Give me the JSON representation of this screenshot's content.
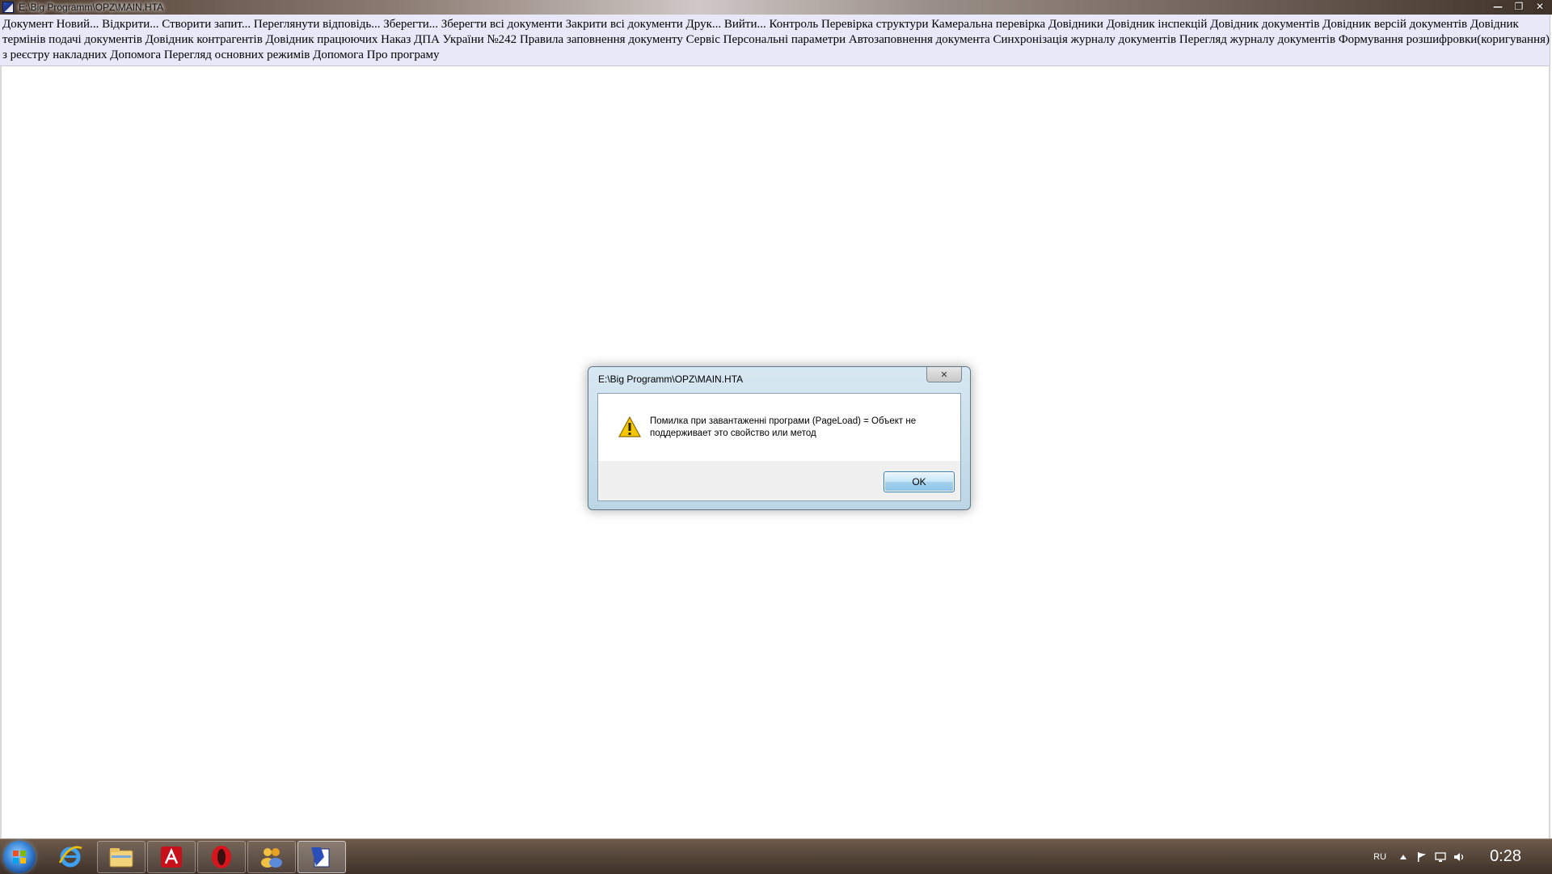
{
  "window": {
    "title": "E:\\Big Programm\\OPZ\\MAIN.HTA",
    "controls": {
      "minimize": "—",
      "maximize": "❐",
      "close": "✕"
    }
  },
  "menu": {
    "items": [
      "Документ",
      "Новий...",
      "Відкрити...",
      "Створити запит...",
      "Переглянути відповідь...",
      "Зберегти...",
      "Зберегти всі документи",
      "Закрити всі документи",
      "Друк...",
      "Вийти...",
      "Контроль",
      "Перевірка структури",
      "Камеральна перевірка",
      "Довідники",
      "Довідник інспекцій",
      "Довідник документів",
      "Довідник версій документів",
      "Довідник термінів подачі документів",
      "Довідник контрагентів",
      "Довідник працюючих",
      "Наказ ДПА України №242",
      "Правила заповнення документу",
      "Сервіс",
      "Персональні параметри",
      "Автозаповнення документа",
      "Синхронізація журналу документів",
      "Перегляд журналу документів",
      "Формування розшифровки(коригування) з реєстру накладних",
      "Допомога",
      "Перегляд основних режимів",
      "Допомога",
      "Про програму"
    ]
  },
  "dialog": {
    "title": "E:\\Big Programm\\OPZ\\MAIN.HTA",
    "message": "Помилка при завантаженні програми (PageLoad) = Объект не поддерживает это свойство или метод",
    "ok_label": "OK",
    "close_label": "✕",
    "icon": "warning-icon"
  },
  "taskbar": {
    "apps": [
      {
        "name": "internet-explorer-icon"
      },
      {
        "name": "file-explorer-icon"
      },
      {
        "name": "adobe-reader-icon"
      },
      {
        "name": "opera-icon"
      },
      {
        "name": "people-app-icon"
      },
      {
        "name": "hta-app-icon"
      }
    ],
    "tray": {
      "language": "RU",
      "clock": "0:28"
    }
  },
  "colors": {
    "menu_bg": "#e8e8f8",
    "dialog_border": "#5e7a8a",
    "ok_button": "#8cc3e6"
  }
}
